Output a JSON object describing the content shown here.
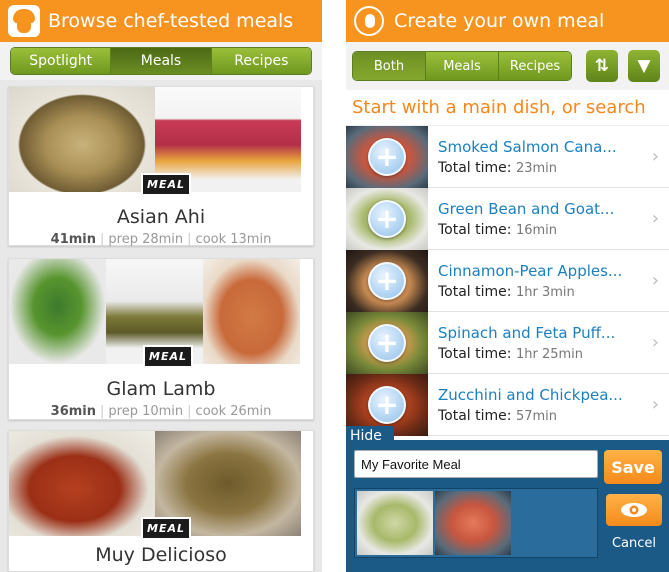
{
  "left": {
    "title": "Browse chef-tested meals",
    "tabs": [
      {
        "label": "Spotlight",
        "selected": false
      },
      {
        "label": "Meals",
        "selected": true
      },
      {
        "label": "Recipes",
        "selected": false
      }
    ],
    "badge_text": "MEAL",
    "meals": [
      {
        "name": "Asian Ahi",
        "total": "41min",
        "prep": "prep 28min",
        "cook": "cook 13min"
      },
      {
        "name": "Glam Lamb",
        "total": "36min",
        "prep": "prep 10min",
        "cook": "cook 26min"
      },
      {
        "name": "Muy Delicioso",
        "total": "",
        "prep": "",
        "cook": ""
      }
    ]
  },
  "right": {
    "title": "Create your own meal",
    "tabs": [
      {
        "label": "Both",
        "selected": true
      },
      {
        "label": "Meals",
        "selected": false
      },
      {
        "label": "Recipes",
        "selected": false
      }
    ],
    "hint": "Start with a main dish, or search",
    "time_label": "Total time:",
    "recipes": [
      {
        "title": "Smoked Salmon Cana...",
        "time": "23min"
      },
      {
        "title": "Green Bean and Goat...",
        "time": "16min"
      },
      {
        "title": "Cinnamon-Pear Apples...",
        "time": "1hr 3min"
      },
      {
        "title": "Spinach and Feta Puff...",
        "time": "1hr 25min"
      },
      {
        "title": "Zucchini and Chickpea...",
        "time": "57min"
      }
    ],
    "tray": {
      "hide_label": "Hide",
      "meal_name_value": "My Favorite Meal",
      "save_label": "Save",
      "cancel_label": "Cancel"
    }
  },
  "colors": {
    "accent_orange": "#f79420",
    "green_tab": "#7da52a",
    "link_blue": "#1b7fc0",
    "tray_blue": "#1b5a87"
  }
}
